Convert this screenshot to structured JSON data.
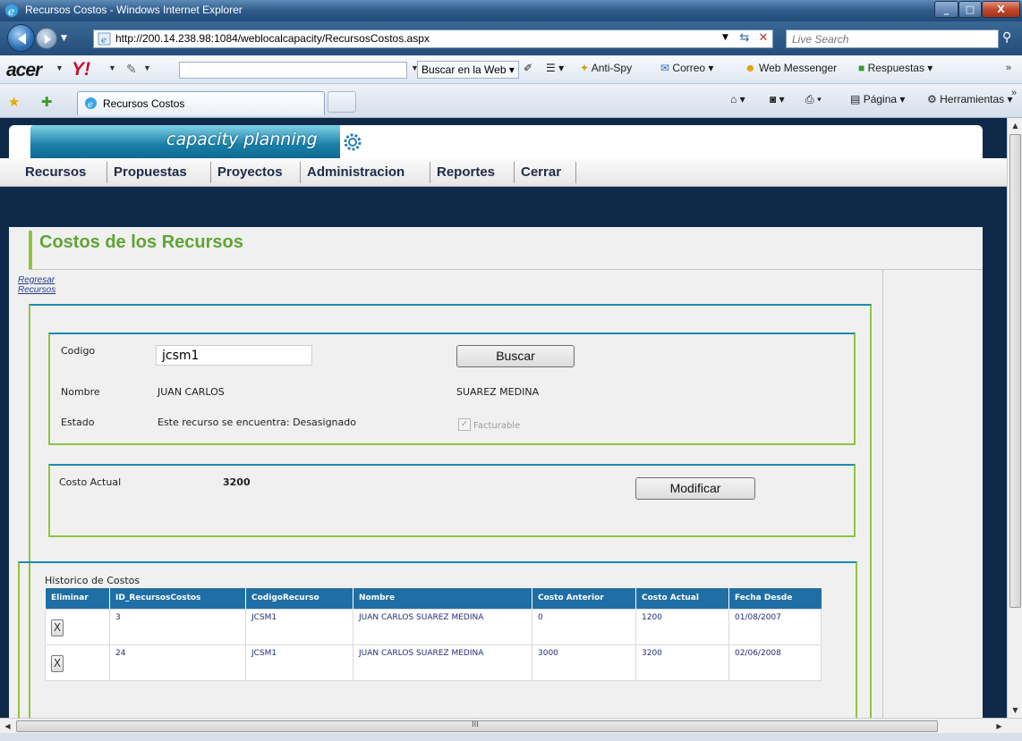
{
  "window": {
    "title": "Recursos Costos - Windows Internet Explorer"
  },
  "address": {
    "url": "http://200.14.238.98:1084/weblocalcapacity/RecursosCostos.aspx",
    "search_placeholder": "Live Search"
  },
  "toolbar": {
    "buscar": "Buscar en la Web",
    "antispy": "Anti-Spy",
    "correo": "Correo",
    "messenger": "Web Messenger",
    "respuestas": "Respuestas"
  },
  "tabbar": {
    "tab_label": "Recursos Costos",
    "pagina": "Página",
    "herramientas": "Herramientas"
  },
  "app": {
    "logo": "capacity planning",
    "menu": [
      "Recursos",
      "Propuestas",
      "Proyectos",
      "Administracion",
      "Reportes",
      "Cerrar"
    ]
  },
  "page": {
    "title": "Costos de los Recursos",
    "link_regresar": "Regresar",
    "link_recursos": "Recursos"
  },
  "resource": {
    "codigo_label": "Codigo",
    "codigo_value": "jcsm1",
    "buscar_button": "Buscar",
    "nombre_label": "Nombre",
    "nombre": "JUAN CARLOS",
    "apellidos": "SUAREZ MEDINA",
    "estado_label": "Estado",
    "estado": "Este recurso se encuentra: Desasignado",
    "facturable": "Facturable"
  },
  "cost": {
    "label": "Costo Actual",
    "value": "3200",
    "modificar_button": "Modificar"
  },
  "history": {
    "title": "Historico de Costos",
    "columns": [
      "Eliminar",
      "ID_RecursosCostos",
      "CodigoRecurso",
      "Nombre",
      "Costo Anterior",
      "Costo Actual",
      "Fecha Desde"
    ],
    "rows": [
      {
        "delete": "X",
        "id": "3",
        "codigo": "JCSM1",
        "nombre": "JUAN CARLOS SUAREZ MEDINA",
        "anterior": "0",
        "actual": "1200",
        "fecha": "01/08/2007"
      },
      {
        "delete": "X",
        "id": "24",
        "codigo": "JCSM1",
        "nombre": "JUAN CARLOS SUAREZ MEDINA",
        "anterior": "3000",
        "actual": "3200",
        "fecha": "02/06/2008"
      }
    ]
  },
  "scrollbar": {
    "h_glyph": "III"
  },
  "colors": {
    "accent_green": "#8cc63f",
    "title_green": "#5fa531",
    "header_blue": "#1f6fa5",
    "frame_blue": "#1a8bb5"
  }
}
